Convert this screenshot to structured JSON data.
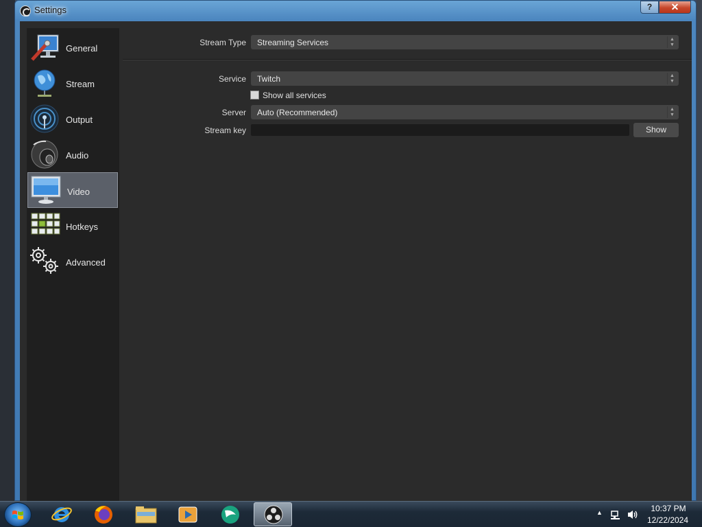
{
  "window": {
    "title": "Settings",
    "help_button": "?",
    "close_button": "✕"
  },
  "sidebar": {
    "items": [
      {
        "label": "General",
        "icon": "general-icon"
      },
      {
        "label": "Stream",
        "icon": "stream-globe-icon"
      },
      {
        "label": "Output",
        "icon": "output-antenna-icon"
      },
      {
        "label": "Audio",
        "icon": "audio-speaker-icon"
      },
      {
        "label": "Video",
        "icon": "video-monitor-icon",
        "active": true
      },
      {
        "label": "Hotkeys",
        "icon": "hotkeys-keyboard-icon"
      },
      {
        "label": "Advanced",
        "icon": "advanced-gears-icon"
      }
    ]
  },
  "stream": {
    "stream_type_label": "Stream Type",
    "stream_type_value": "Streaming Services",
    "service_label": "Service",
    "service_value": "Twitch",
    "show_all_label": "Show all services",
    "show_all_checked": false,
    "server_label": "Server",
    "server_value": "Auto (Recommended)",
    "stream_key_label": "Stream key",
    "stream_key_value": "",
    "show_button": "Show"
  },
  "taskbar": {
    "apps": [
      "internet-explorer-icon",
      "firefox-icon",
      "file-explorer-icon",
      "media-player-icon",
      "kde-connect-icon",
      "obs-icon"
    ],
    "time": "10:37 PM",
    "date": "12/22/2024"
  },
  "colors": {
    "window_bg": "#2b2b2b",
    "sidebar_bg": "#1f1f1f",
    "active_item": "#5b6069",
    "combo_bg": "#444444"
  }
}
